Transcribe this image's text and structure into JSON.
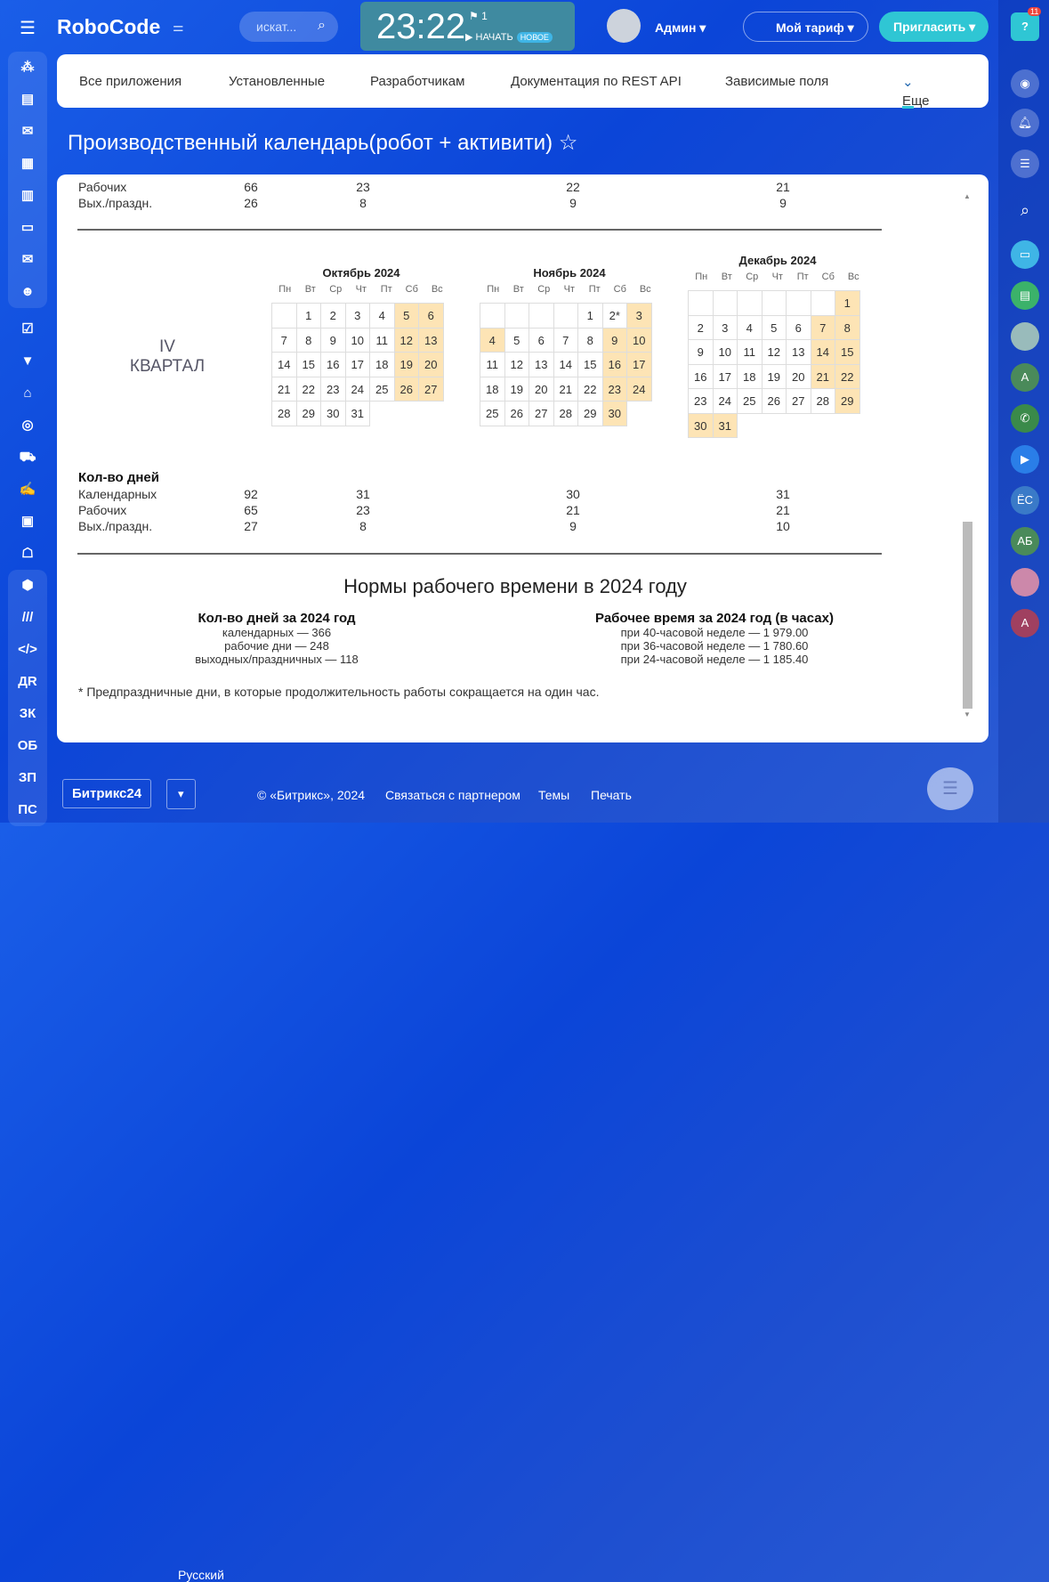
{
  "header": {
    "logo": "RoboCode",
    "search_placeholder": "искат...",
    "time": "23:22",
    "flag_count": "1",
    "start": "НАЧАТЬ",
    "new_badge": "НОВОЕ",
    "user": "Админ",
    "tariff": "Мой тариф",
    "invite": "Пригласить"
  },
  "left_sidebar": {
    "text_items": [
      "ДR",
      "ЗК",
      "ОБ",
      "ЗП",
      "ПС"
    ]
  },
  "right_sidebar": {
    "help_badge": "11",
    "avatars": [
      "А",
      "ЁС",
      "АБ",
      "А"
    ]
  },
  "nav": {
    "tabs": [
      "Все приложения",
      "Установленные",
      "Разработчикам",
      "Документация по REST API",
      "Зависимые поля",
      "Еще"
    ]
  },
  "page_title": "Производственный календарь(робот + активити)",
  "prev_quarter": {
    "rows": [
      {
        "label": "Рабочих",
        "values": [
          "66",
          "23",
          "22",
          "21"
        ]
      },
      {
        "label": "Вых./праздн.",
        "values": [
          "26",
          "8",
          "9",
          "9"
        ]
      }
    ]
  },
  "quarter": {
    "label1": "IV",
    "label2": "КВАРТАЛ"
  },
  "weekdays": [
    "Пн",
    "Вт",
    "Ср",
    "Чт",
    "Пт",
    "Сб",
    "Вс"
  ],
  "months": [
    {
      "title": "Октябрь 2024",
      "offset": 1,
      "days": 31,
      "weekend": [
        5,
        6,
        12,
        13,
        19,
        20,
        26,
        27
      ],
      "labels": {}
    },
    {
      "title": "Ноябрь 2024",
      "offset": 4,
      "days": 30,
      "weekend": [
        3,
        4,
        9,
        10,
        16,
        17,
        23,
        24,
        30
      ],
      "labels": {
        "2": "2*"
      }
    },
    {
      "title": "Декабрь 2024",
      "offset": 6,
      "days": 31,
      "weekend": [
        1,
        7,
        8,
        14,
        15,
        21,
        22,
        29,
        30,
        31
      ],
      "labels": {}
    }
  ],
  "days_count": {
    "title": "Кол-во дней",
    "rows": [
      {
        "label": "Календарных",
        "values": [
          "92",
          "31",
          "30",
          "31"
        ]
      },
      {
        "label": "Рабочих",
        "values": [
          "65",
          "23",
          "21",
          "21"
        ]
      },
      {
        "label": "Вых./праздн.",
        "values": [
          "27",
          "8",
          "9",
          "10"
        ]
      }
    ]
  },
  "norms": {
    "title": "Нормы рабочего времени в 2024 году",
    "left": {
      "title": "Кол-во дней за 2024 год",
      "lines": [
        "календарных — 366",
        "рабочие дни — 248",
        "выходных/праздничных — 118"
      ]
    },
    "right": {
      "title": "Рабочее время за 2024 год (в часах)",
      "lines": [
        "при 40-часовой неделе — 1 979.00",
        "при 36-часовой неделе — 1 780.60",
        "при 24-часовой неделе — 1 185.40"
      ]
    },
    "note": "* Предпраздничные дни, в которые продолжительность работы сокращается на один час."
  },
  "footer": {
    "brand": "Битрикс24",
    "lang": "Русский",
    "copyright": "© «Битрикс», 2024",
    "partner": "Связаться с партнером",
    "themes": "Темы",
    "print": "Печать"
  }
}
